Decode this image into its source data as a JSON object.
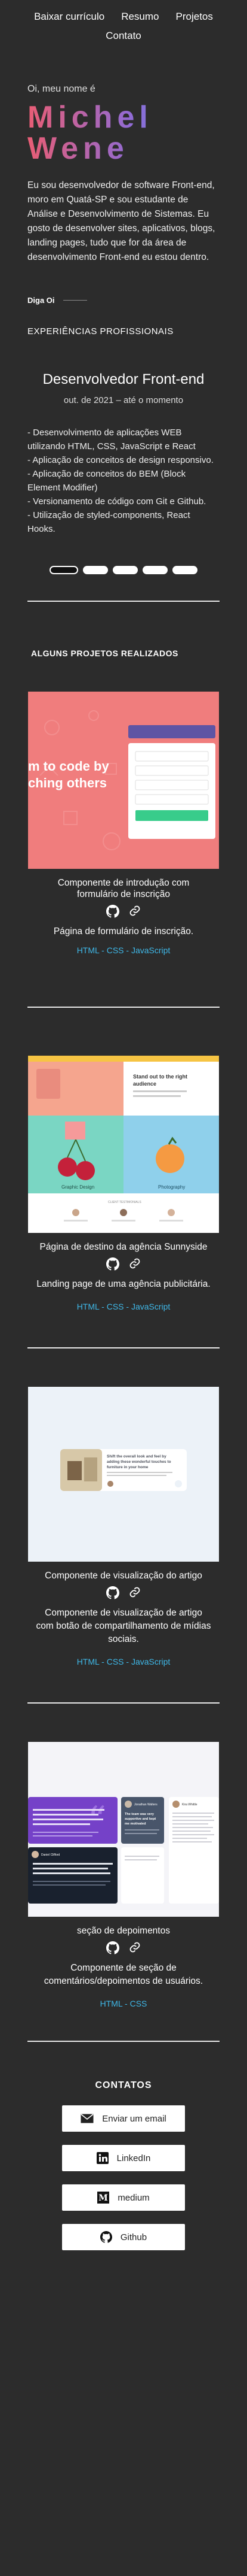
{
  "nav": {
    "items": [
      {
        "label": "Baixar currículo"
      },
      {
        "label": "Resumo"
      },
      {
        "label": "Projetos"
      },
      {
        "label": "Contato"
      }
    ]
  },
  "hero": {
    "greeting": "Oi, meu nome é",
    "name_line1": "Michel",
    "name_line2": "Wene",
    "intro": "Eu sou desenvolvedor de software Front-end, moro em Quatá-SP e sou estudante de Análise e Desenvolvimento de Sistemas. Eu gosto de desenvolver sites, aplicativos, blogs, landing pages, tudo que for da área de desenvolvimento Front-end eu estou dentro.",
    "say_hi": "Diga Oi"
  },
  "experience": {
    "section_label": "EXPERIÊNCIAS PROFISSIONAIS",
    "title": "Desenvolvedor Front-end",
    "period": "out. de 2021 – até o momento",
    "items": [
      "- Desenvolvimento de aplicações WEB utilizando HTML, CSS, JavaScript e React",
      "- Aplicação de conceitos de design responsivo.",
      "- Aplicação de conceitos do BEM (Block Element Modifier)",
      "- Versionamento de código com Git e Github.",
      "- Utilização de styled-components, React Hooks."
    ],
    "active_dot": 0
  },
  "projects": {
    "section_label": "ALGUNS PROJETOS REALIZADOS",
    "items": [
      {
        "title": "Componente de introdução com formulário de inscrição",
        "description": "Página de formulário de inscrição.",
        "tech": "HTML - CSS - JavaScript",
        "shot_text": "m to code by\nching others",
        "shot_button": "Claim your free trial",
        "shot_form_button": "CLAIM YOUR FREE TRIAL"
      },
      {
        "title": "Página de destino da agência Sunnyside",
        "description": "Landing page de uma agência publicitária.",
        "tech": "HTML - CSS - JavaScript",
        "shot_heading": "Stand out to the right audience",
        "shot_label1": "Graphic Design",
        "shot_label2": "Photography"
      },
      {
        "title": "Componente de visualização do artigo",
        "description": "Componente de visualização de artigo com botão de compartilhamento de mídias sociais.",
        "tech": "HTML - CSS - JavaScript",
        "shot_heading": "Shift the overall look and feel by adding these wonderful touches to furniture in your home"
      },
      {
        "title": "seção de depoimentos",
        "description": "Componente de seção de comentários/depoimentos de usuários.",
        "tech": "HTML - CSS",
        "shot_name1": "Daniel Clifford",
        "shot_name2": "Jonathan Walters",
        "shot_quote1": "I received a job offer mid-course, and the subjects I learned were current, if not more so, in the company I joined. I honestly feel I got every penny's worth.",
        "shot_quote2": "The team was very supportive and kept me motivated",
        "shot_name3": "Kira Whittle",
        "shot_quote3": "Awesome teaching support from TAs who did the bootcamp before you. Leading guidance from them and learning from their experiences was easy."
      }
    ]
  },
  "contacts": {
    "title": "CONTATOS",
    "items": [
      {
        "label": "Enviar um email",
        "icon": "mail-icon"
      },
      {
        "label": "LinkedIn",
        "icon": "linkedin-icon"
      },
      {
        "label": "medium",
        "icon": "medium-icon"
      },
      {
        "label": "Github",
        "icon": "github-icon"
      }
    ]
  },
  "colors": {
    "background": "#2c2c2c",
    "accent": "#3fb8e8",
    "gradient_start": "#e85d75",
    "gradient_end": "#5a8fe0"
  }
}
